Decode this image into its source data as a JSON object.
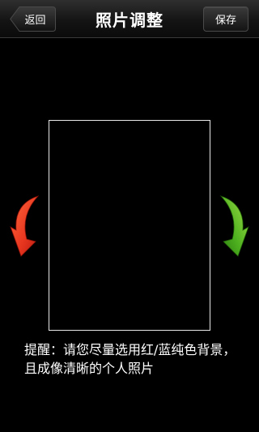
{
  "header": {
    "back_label": "返回",
    "title": "照片调整",
    "save_label": "保存"
  },
  "arrows": {
    "left_icon": "rotate-left-arrow-icon",
    "left_color": "#e8361f",
    "right_icon": "rotate-right-arrow-icon",
    "right_color": "#4caf1e"
  },
  "tip": {
    "text": "提醒：请您尽量选用红/蓝纯色背景，且成像清晰的个人照片"
  }
}
